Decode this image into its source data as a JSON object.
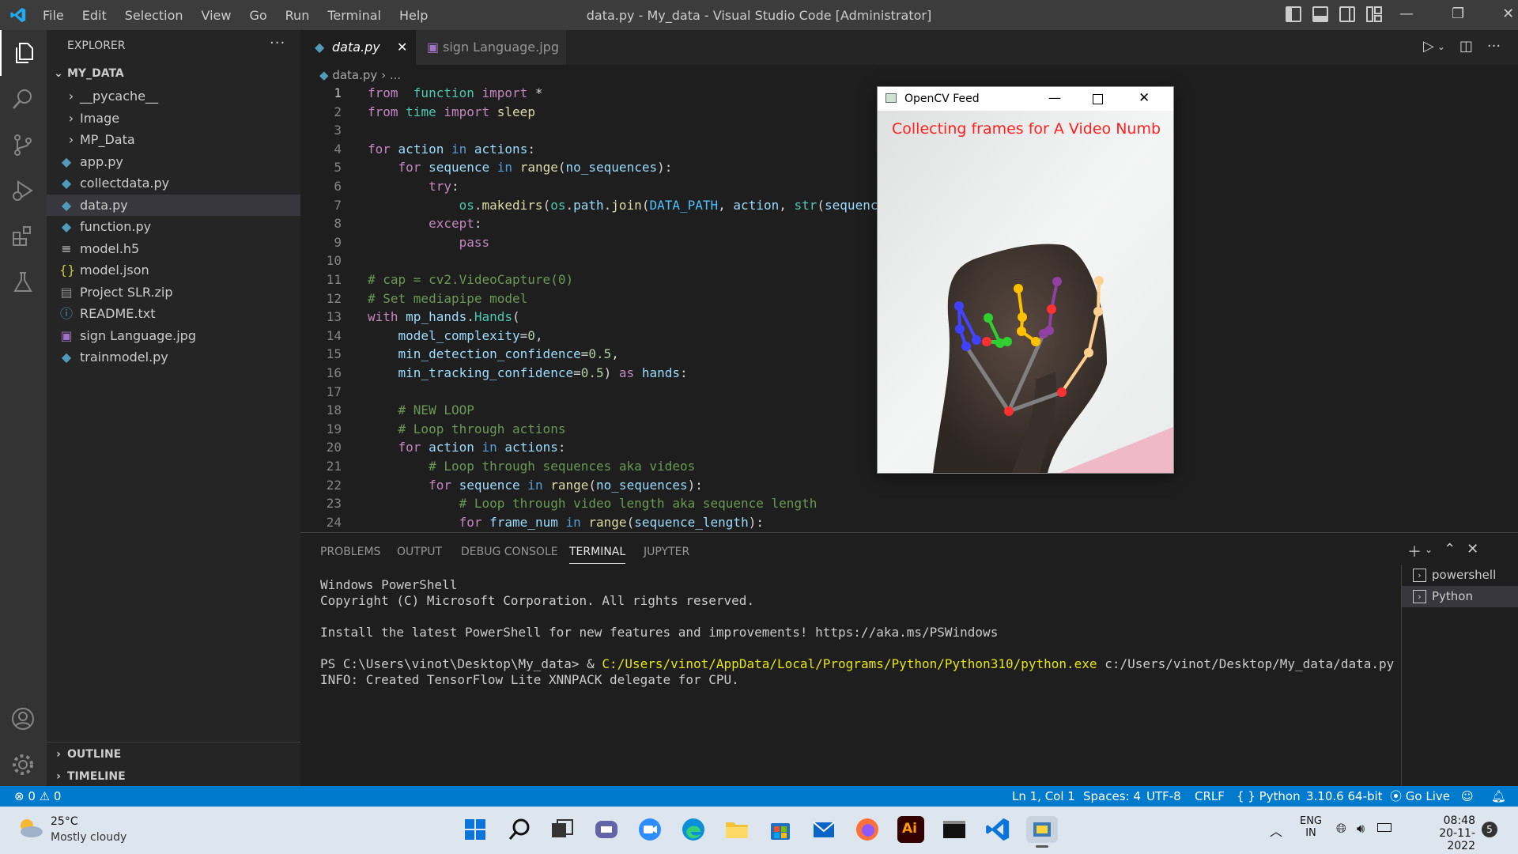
{
  "titlebar": {
    "menus": [
      "File",
      "Edit",
      "Selection",
      "View",
      "Go",
      "Run",
      "Terminal",
      "Help"
    ],
    "title": "data.py - My_data - Visual Studio Code [Administrator]"
  },
  "explorer": {
    "header": "EXPLORER",
    "more": "···",
    "root": "MY_DATA",
    "items": [
      {
        "name": "__pycache__",
        "kind": "folder"
      },
      {
        "name": "Image",
        "kind": "folder"
      },
      {
        "name": "MP_Data",
        "kind": "folder"
      },
      {
        "name": "app.py",
        "kind": "python"
      },
      {
        "name": "collectdata.py",
        "kind": "python"
      },
      {
        "name": "data.py",
        "kind": "python",
        "selected": true
      },
      {
        "name": "function.py",
        "kind": "python"
      },
      {
        "name": "model.h5",
        "kind": "text"
      },
      {
        "name": "model.json",
        "kind": "json"
      },
      {
        "name": "Project SLR.zip",
        "kind": "zip"
      },
      {
        "name": "README.txt",
        "kind": "info"
      },
      {
        "name": "sign Language.jpg",
        "kind": "image"
      },
      {
        "name": "trainmodel.py",
        "kind": "python"
      }
    ],
    "outline": "OUTLINE",
    "timeline": "TIMELINE"
  },
  "tabs": [
    {
      "label": "data.py",
      "active": true
    },
    {
      "label": "sign Language.jpg",
      "active": false
    }
  ],
  "breadcrumb": {
    "file": "data.py",
    "rest": "..."
  },
  "code": [
    [
      [
        "kw",
        "from"
      ],
      [
        "",
        "  "
      ],
      [
        "ty",
        "function"
      ],
      [
        "",
        ""
      ],
      [
        "kw",
        " import"
      ],
      [
        "",
        " *"
      ]
    ],
    [
      [
        "kw",
        "from"
      ],
      [
        "",
        " "
      ],
      [
        "ty",
        "time"
      ],
      [
        "kw",
        " import"
      ],
      [
        "",
        " "
      ],
      [
        "fn",
        "sleep"
      ]
    ],
    [],
    [
      [
        "kw",
        "for"
      ],
      [
        "",
        " "
      ],
      [
        "vr",
        "action"
      ],
      [
        "kb",
        " in"
      ],
      [
        "",
        " "
      ],
      [
        "vr",
        "actions"
      ],
      [
        "",
        ":"
      ]
    ],
    [
      [
        "",
        "    "
      ],
      [
        "kw",
        "for"
      ],
      [
        "",
        " "
      ],
      [
        "vr",
        "sequence"
      ],
      [
        "kb",
        " in"
      ],
      [
        "",
        " "
      ],
      [
        "fn",
        "range"
      ],
      [
        "",
        "("
      ],
      [
        "vr",
        "no_sequences"
      ],
      [
        "",
        "):"
      ]
    ],
    [
      [
        "",
        "        "
      ],
      [
        "kw",
        "try"
      ],
      [
        "",
        ":"
      ]
    ],
    [
      [
        "",
        "            "
      ],
      [
        "ty",
        "os"
      ],
      [
        "",
        "."
      ],
      [
        "vr",
        "path"
      ],
      [
        "",
        ""
      ],
      [
        "",
        ""
      ],
      [
        "",
        "."
      ],
      [
        "fn",
        "makedirs"
      ]
    ],
    [
      [
        "",
        "        "
      ],
      [
        "kw",
        "except"
      ],
      [
        "",
        ":"
      ]
    ],
    [
      [
        "",
        "            "
      ],
      [
        "kw",
        "pass"
      ]
    ],
    [],
    [
      [
        "cm",
        "# cap = cv2.VideoCapture(0)"
      ]
    ],
    [
      [
        "cm",
        "# Set mediapipe model"
      ]
    ],
    [
      [
        "kw",
        "with"
      ],
      [
        "",
        " "
      ],
      [
        "vr",
        "mp_hands"
      ],
      [
        "",
        "."
      ],
      [
        "ty",
        "Hands"
      ],
      [
        "",
        "("
      ]
    ],
    [
      [
        "",
        "    "
      ],
      [
        "vr",
        "model_complexity"
      ],
      [
        "",
        "="
      ],
      [
        "nm",
        "0"
      ],
      [
        "",
        ","
      ]
    ],
    [
      [
        "",
        "    "
      ],
      [
        "vr",
        "min_detection_confidence"
      ],
      [
        "",
        "="
      ],
      [
        "nm",
        "0.5"
      ],
      [
        "",
        ","
      ]
    ],
    [
      [
        "",
        "    "
      ],
      [
        "vr",
        "min_tracking_confidence"
      ],
      [
        "",
        "="
      ],
      [
        "nm",
        "0.5"
      ],
      [
        "",
        ") "
      ],
      [
        "kw",
        "as"
      ],
      [
        "",
        " "
      ],
      [
        "vr",
        "hands"
      ],
      [
        "",
        ":"
      ]
    ],
    [],
    [
      [
        "",
        "    "
      ],
      [
        "cm",
        "# NEW LOOP"
      ]
    ],
    [
      [
        "",
        "    "
      ],
      [
        "cm",
        "# Loop through actions"
      ]
    ],
    [
      [
        "",
        "    "
      ],
      [
        "kw",
        "for"
      ],
      [
        "",
        " "
      ],
      [
        "vr",
        "action"
      ],
      [
        "kb",
        " in"
      ],
      [
        "",
        " "
      ],
      [
        "vr",
        "actions"
      ],
      [
        "",
        ":"
      ]
    ],
    [
      [
        "",
        "        "
      ],
      [
        "cm",
        "# Loop through sequences aka videos"
      ]
    ],
    [
      [
        "",
        "        "
      ],
      [
        "kw",
        "for"
      ],
      [
        "",
        " "
      ],
      [
        "vr",
        "sequence"
      ],
      [
        "kb",
        " in"
      ],
      [
        "",
        " "
      ],
      [
        "fn",
        "range"
      ],
      [
        "",
        "("
      ],
      [
        "vr",
        "no_sequences"
      ],
      [
        "",
        "):"
      ]
    ],
    [
      [
        "",
        "            "
      ],
      [
        "cm",
        "# Loop through video length aka sequence length"
      ]
    ],
    [
      [
        "",
        "            "
      ],
      [
        "kw",
        "for"
      ],
      [
        "",
        " "
      ],
      [
        "vr",
        "frame_num"
      ],
      [
        "kb",
        " in"
      ],
      [
        "",
        " "
      ],
      [
        "fn",
        "range"
      ],
      [
        "",
        "("
      ],
      [
        "vr",
        "sequence_length"
      ],
      [
        "",
        "):"
      ]
    ]
  ],
  "line7_full": "            os.makedirs(os.path.join(DATA_PATH, action, str(sequenc",
  "panel": {
    "tabs": [
      "PROBLEMS",
      "OUTPUT",
      "DEBUG CONSOLE",
      "TERMINAL",
      "JUPYTER"
    ],
    "active": "TERMINAL",
    "terminal": [
      "Windows PowerShell",
      "Copyright (C) Microsoft Corporation. All rights reserved.",
      "",
      "Install the latest PowerShell for new features and improvements! https://aka.ms/PSWindows",
      "",
      "",
      "INFO: Created TensorFlow Lite XNNPACK delegate for CPU."
    ],
    "prompt": "PS C:\\Users\\vinot\\Desktop\\My_data> & ",
    "exe": "C:/Users/vinot/AppData/Local/Programs/Python/Python310/python.exe",
    "arg": " c:/Users/vinot/Desktop/My_data/data.py",
    "terminals": [
      {
        "name": "powershell",
        "selected": false
      },
      {
        "name": "Python",
        "selected": true
      }
    ]
  },
  "status": {
    "errors": "0",
    "warnings": "0",
    "position": "Ln 1, Col 1",
    "spaces": "Spaces: 4",
    "encoding": "UTF-8",
    "eol": "CRLF",
    "lang": "Python",
    "interpreter": "3.10.6 64-bit",
    "golive": "Go Live"
  },
  "opencv": {
    "title": "OpenCV Feed",
    "overlay": "Collecting frames for A Video Numb"
  },
  "taskbar": {
    "temp": "25°C",
    "weather": "Mostly cloudy",
    "lang1": "ENG",
    "lang2": "IN",
    "time": "08:48",
    "date": "20-11-2022",
    "badge": "5"
  },
  "colors": {
    "accent": "#007acc",
    "titlebar": "#3c3c3c",
    "activity": "#333333",
    "sidebar": "#252526",
    "editor": "#1e1e1e"
  }
}
